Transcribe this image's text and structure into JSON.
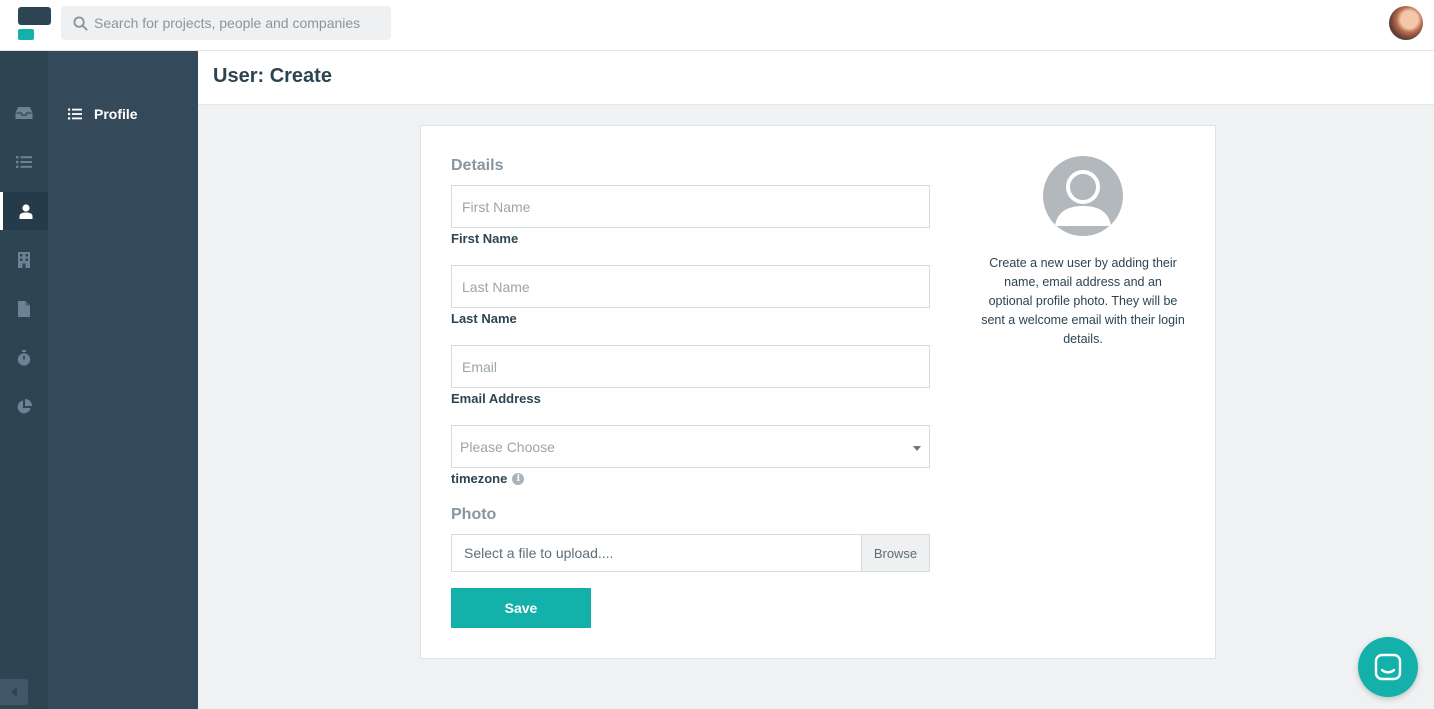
{
  "search": {
    "placeholder": "Search for projects, people and companies"
  },
  "header": {
    "title": "User: Create"
  },
  "subnav": {
    "items": [
      {
        "label": "Profile",
        "icon": "list-icon"
      }
    ]
  },
  "rail": {
    "items": [
      "inbox-icon",
      "list-icon",
      "user-icon",
      "building-icon",
      "file-icon",
      "stopwatch-icon",
      "pie-chart-icon"
    ],
    "active": "user-icon"
  },
  "form": {
    "details_title": "Details",
    "first_name": {
      "placeholder": "First Name",
      "label": "First Name"
    },
    "last_name": {
      "placeholder": "Last Name",
      "label": "Last Name"
    },
    "email": {
      "placeholder": "Email",
      "label": "Email Address"
    },
    "timezone": {
      "selected": "Please Choose",
      "label": "timezone"
    },
    "photo_title": "Photo",
    "file": {
      "placeholder": "Select a file to upload....",
      "browse_label": "Browse"
    },
    "save_label": "Save"
  },
  "help": {
    "text": "Create a new user by adding their name, email address and an optional profile photo. They will be sent a welcome email with their login details."
  },
  "colors": {
    "accent": "#14b1ab",
    "sidebar": "#2d4453",
    "subnav": "#34495a"
  }
}
